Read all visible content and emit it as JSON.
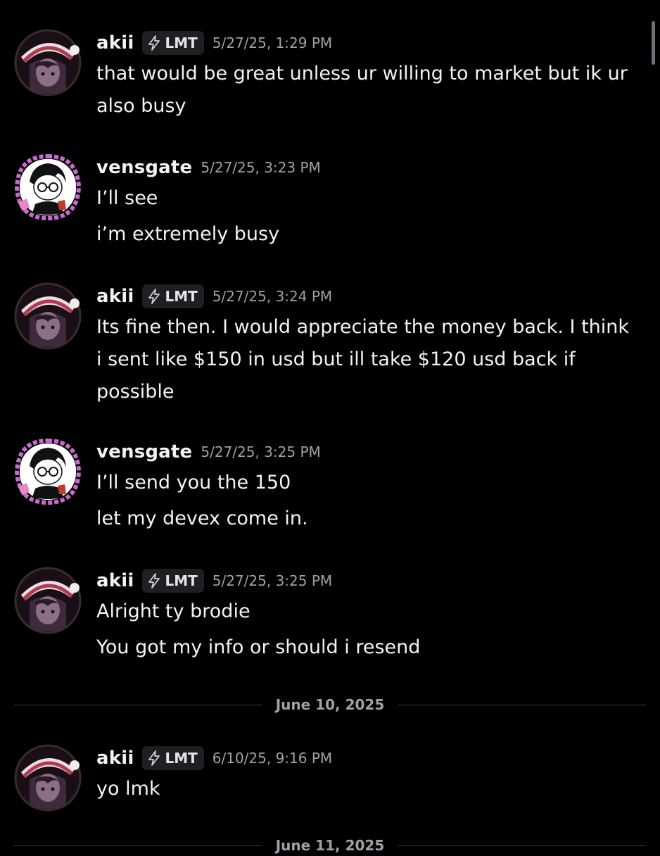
{
  "messages": [
    {
      "author": "akii",
      "tag": "LMT",
      "time": "5/27/25, 1:29 PM",
      "avatar": "anime-girl-santa-hat",
      "lines": [
        "that would be great unless ur willing to market but ik ur also busy"
      ]
    },
    {
      "author": "vensgate",
      "time": "5/27/25, 3:23 PM",
      "avatar": "anime-boy-glasses",
      "lines": [
        "I’ll see",
        "i’m extremely busy"
      ]
    },
    {
      "author": "akii",
      "tag": "LMT",
      "time": "5/27/25, 3:24 PM",
      "avatar": "anime-girl-santa-hat",
      "lines": [
        "Its fine then. I would appreciate the money back. I think i sent like $150 in usd but ill take $120 usd back if possible"
      ]
    },
    {
      "author": "vensgate",
      "time": "5/27/25, 3:25 PM",
      "avatar": "anime-boy-glasses",
      "lines": [
        "I’ll send you the 150",
        "let my devex come in."
      ]
    },
    {
      "author": "akii",
      "tag": "LMT",
      "time": "5/27/25, 3:25 PM",
      "avatar": "anime-girl-santa-hat",
      "lines": [
        "Alright ty brodie",
        "You got my info or should i resend"
      ]
    },
    {
      "author": "akii",
      "tag": "LMT",
      "time": "6/10/25, 9:16 PM",
      "avatar": "anime-girl-santa-hat",
      "lines": [
        "yo lmk"
      ]
    }
  ],
  "dividers": [
    "June 10, 2025",
    "June 11, 2025"
  ],
  "icons": {
    "tag_icon": "lightning-bolt-icon"
  },
  "colors": {
    "background": "#000000",
    "text": "#f2f3f5",
    "muted": "#9ea2a8",
    "tag_bg": "#1e1f22",
    "avatar_frame": "#c86bd0"
  }
}
